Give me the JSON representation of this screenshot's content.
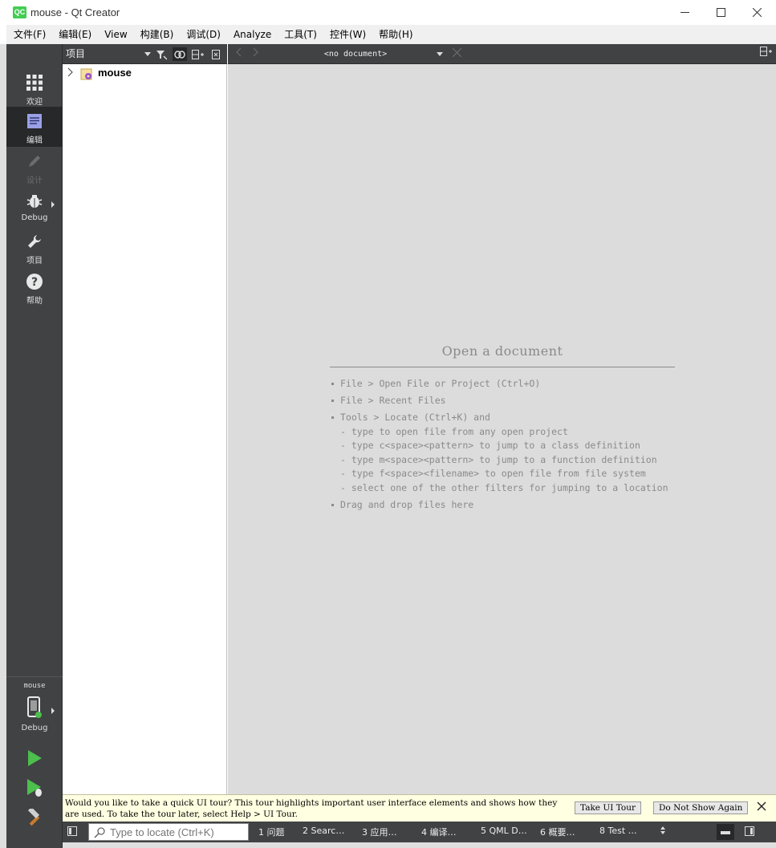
{
  "window": {
    "app_icon_text": "QC",
    "title": "mouse - Qt Creator"
  },
  "menu": [
    "文件(F)",
    "编辑(E)",
    "View",
    "构建(B)",
    "调试(D)",
    "Analyze",
    "工具(T)",
    "控件(W)",
    "帮助(H)"
  ],
  "modes": {
    "welcome": "欢迎",
    "edit": "编辑",
    "design": "设计",
    "debug": "Debug",
    "projects": "项目",
    "help": "帮助"
  },
  "kit": {
    "project": "mouse",
    "build_config": "Debug"
  },
  "project_pane": {
    "view_label": "项目",
    "tree_root": "mouse"
  },
  "editor_toolbar": {
    "document": "<no document>"
  },
  "welcome": {
    "title": "Open a document",
    "item1": "File > Open File or Project (Ctrl+O)",
    "item2": "File > Recent Files",
    "item3": "Tools > Locate (Ctrl+K) and",
    "sub1": "- type to open file from any open project",
    "sub2": "- type c<space><pattern> to jump to a class definition",
    "sub3": "- type m<space><pattern> to jump to a function definition",
    "sub4": "- type f<space><filename> to open file from file system",
    "sub5": "- select one of the other filters for jumping to a location",
    "item4": "Drag and drop files here"
  },
  "infobar": {
    "text": "Would you like to take a quick UI tour? This tour highlights important user interface elements and shows how they are used. To take the tour later, select Help > UI Tour.",
    "tour_button": "Take UI Tour",
    "dont_show_button": "Do Not Show Again"
  },
  "statusbar": {
    "locator_placeholder": "Type to locate (Ctrl+K)",
    "tabs": [
      "1 问题",
      "2 Searc…",
      "3 应用…",
      "4 编译…",
      "5 QML D…",
      "6 概要…",
      "8 Test …"
    ]
  },
  "colors": {
    "mode_bar": "#404244",
    "mode_active": "#262829",
    "editor_bg": "#dcdcdc",
    "infobar_bg": "#ffffe1",
    "run_green": "#4cbf4c",
    "qt_green": "#41cd52"
  }
}
